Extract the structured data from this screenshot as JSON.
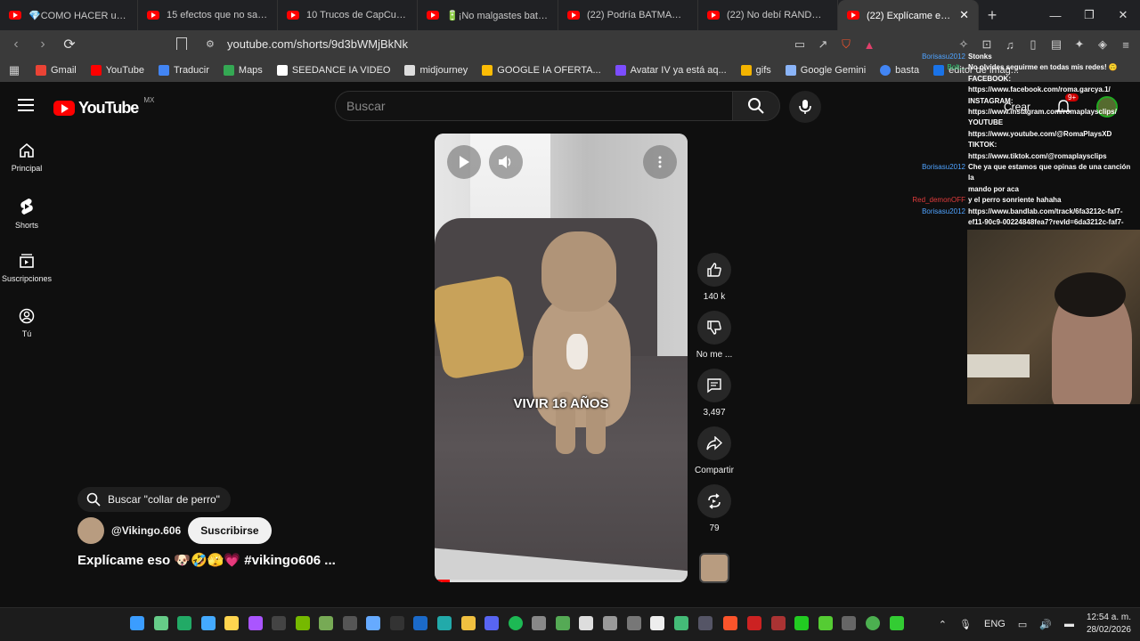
{
  "tabs": [
    {
      "title": "💎COMO HACER una ME..."
    },
    {
      "title": "15 efectos que no sabías q..."
    },
    {
      "title": "10 Trucos de CapCut que ..."
    },
    {
      "title": "🔋¡No malgastes batería!..."
    },
    {
      "title": "(22) Podría BATMAN venc..."
    },
    {
      "title": "(22) No debí RANDOMIZA..."
    },
    {
      "title": "(22) Explícame eso 🐶",
      "close": "✕"
    }
  ],
  "window_controls": {
    "minimize": "—",
    "maximize": "❐",
    "close": "✕"
  },
  "address": {
    "url": "youtube.com/shorts/9d3bWMjBkNk"
  },
  "bookmarks": [
    {
      "label": "Gmail",
      "color": "#ea4335"
    },
    {
      "label": "YouTube",
      "color": "#ff0000"
    },
    {
      "label": "Traducir",
      "color": "#4285f4"
    },
    {
      "label": "Maps",
      "color": "#34a853"
    },
    {
      "label": "SEEDANCE IA VIDEO",
      "color": "#ffffff"
    },
    {
      "label": "midjourney",
      "color": "#dddddd"
    },
    {
      "label": "GOOGLE IA OFERTA...",
      "color": "#fbbc05"
    },
    {
      "label": "Avatar IV ya está aq...",
      "color": "#7c4dff"
    },
    {
      "label": "gifs",
      "color": "#f4b400"
    },
    {
      "label": "Google Gemini",
      "color": "#8ab4f8"
    },
    {
      "label": "basta",
      "color": "#4285f4"
    },
    {
      "label": "editor de imag...",
      "color": "#1a73e8"
    }
  ],
  "youtube": {
    "logo_text": "YouTube",
    "region": "MX",
    "search_placeholder": "Buscar",
    "create_label": "Crear",
    "notification_badge": "9+",
    "sidebar": [
      {
        "label": "Principal"
      },
      {
        "label": "Shorts"
      },
      {
        "label": "Suscripciones"
      },
      {
        "label": "Tú"
      }
    ],
    "video": {
      "caption": "VIVIR 18 AÑOS",
      "progress_percent": 6
    },
    "actions": {
      "likes": "140 k",
      "dislike_label": "No me ...",
      "comments": "3,497",
      "share_label": "Compartir",
      "remix_count": "79"
    },
    "search_chip": "Buscar \"collar de perro\"",
    "channel_name": "@Vikingo.606",
    "subscribe_label": "Suscribirse",
    "video_title": "Explícame eso 🐶🤣🫣💗 #vikingo606 ..."
  },
  "chat": [
    {
      "user": "Borisasu2012",
      "text": "Stonks",
      "color": "#4fa3ff"
    },
    {
      "user": "Bolt...",
      "text": "No olvides seguirme en todas mis redes! 🙃",
      "color": "#2ecc71"
    },
    {
      "user": "",
      "text": "FACEBOOK:"
    },
    {
      "user": "",
      "text": "https://www.facebook.com/roma.garcya.1/"
    },
    {
      "user": "",
      "text": "INSTAGRAM:"
    },
    {
      "user": "",
      "text": "https://www.instagram.com/romaplaysclips/"
    },
    {
      "user": "",
      "text": "YOUTUBE"
    },
    {
      "user": "",
      "text": "https://www.youtube.com/@RomaPlaysXD TIKTOK:"
    },
    {
      "user": "",
      "text": "https://www.tiktok.com/@romaplaysclips"
    },
    {
      "user": "Borisasu2012",
      "text": "Che ya que estamos que opinas de una canción la",
      "color": "#4fa3ff"
    },
    {
      "user": "",
      "text": "mando por aca"
    },
    {
      "user": "Red_demonOFF",
      "text": "y el perro sonriente hahaha",
      "color": "#e23c3c"
    },
    {
      "user": "Borisasu2012",
      "text": "https://www.bandlab.com/track/6fa3212c-faf7-",
      "color": "#4fa3ff"
    },
    {
      "user": "",
      "text": "ef11-90c9-00224848fea7?revId=6da3212c-faf7-"
    },
    {
      "user": "",
      "text": "ef11-90c9-00224848fea7"
    }
  ],
  "tray": {
    "language": "ENG",
    "time": "12:54 a. m.",
    "date": "28/02/2026"
  }
}
